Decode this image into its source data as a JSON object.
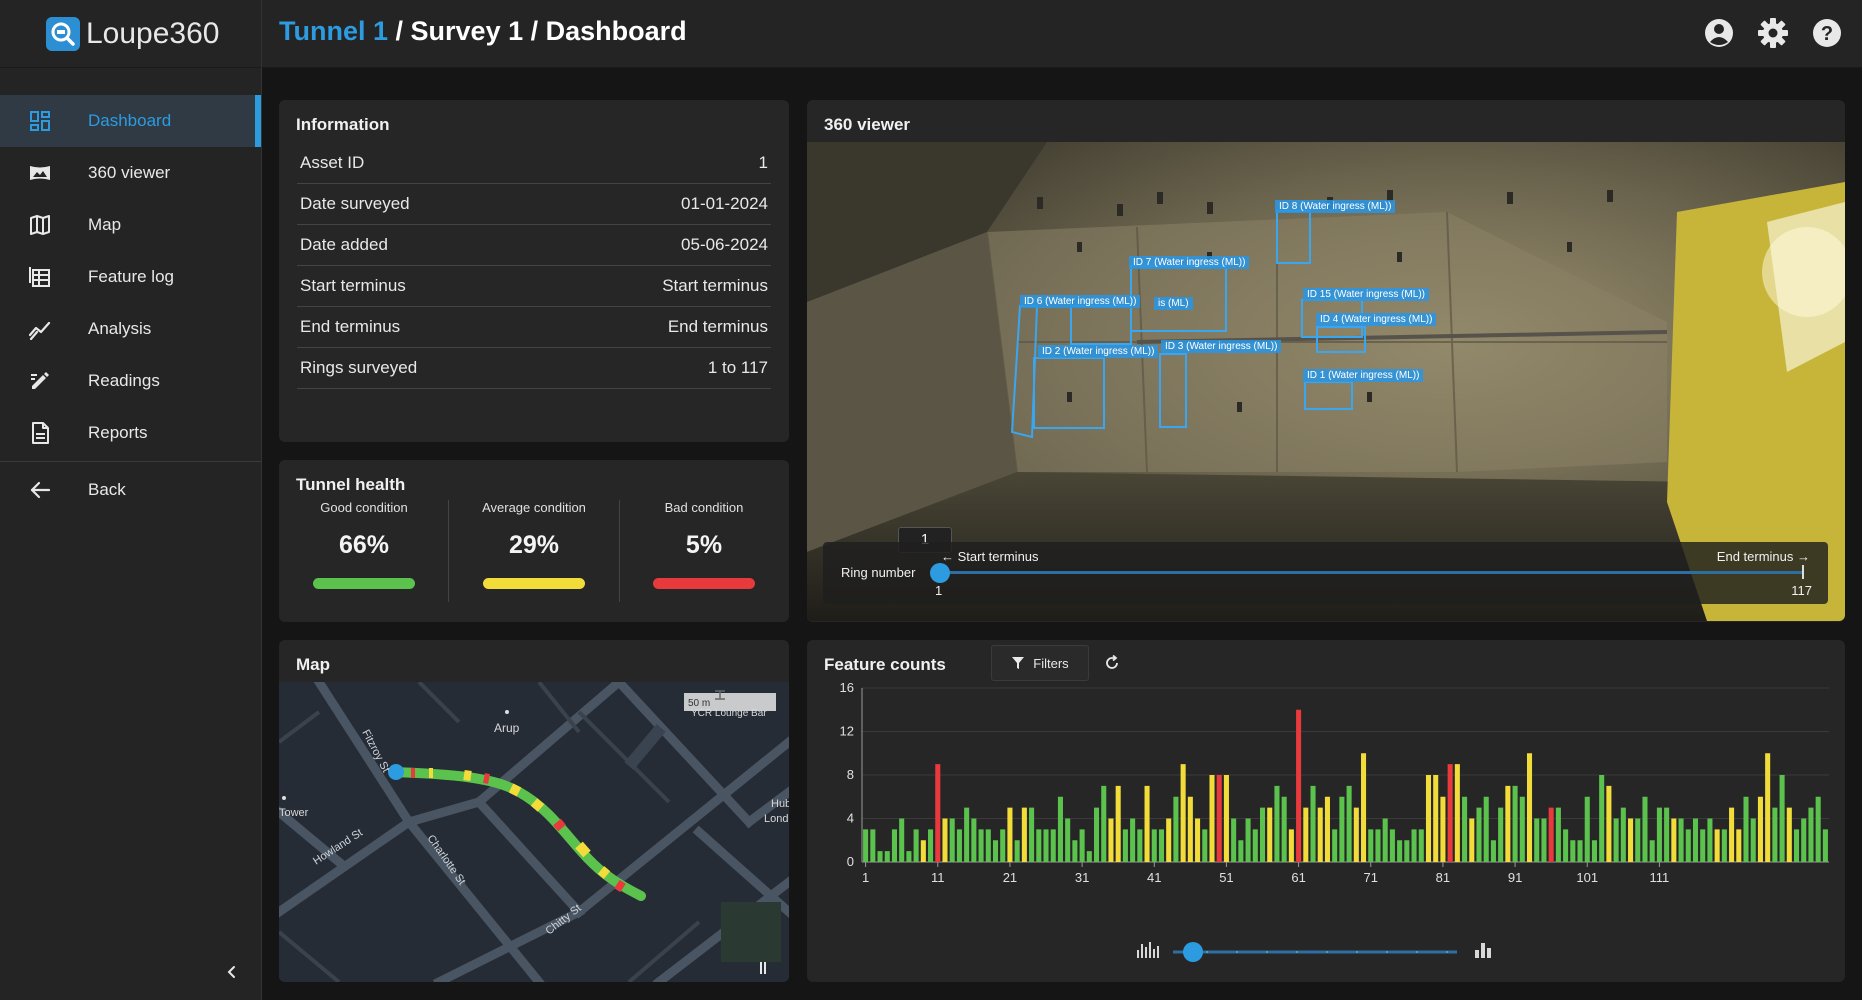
{
  "app": {
    "name": "Loupe360"
  },
  "breadcrumb": {
    "tunnel": "Tunnel 1",
    "sep1": " / ",
    "survey": "Survey 1",
    "sep2": " / ",
    "page": "Dashboard"
  },
  "sidebar": {
    "items": [
      {
        "label": "Dashboard",
        "icon": "dashboard-icon",
        "active": true
      },
      {
        "label": "360 viewer",
        "icon": "panorama-icon"
      },
      {
        "label": "Map",
        "icon": "map-icon"
      },
      {
        "label": "Feature log",
        "icon": "table-icon"
      },
      {
        "label": "Analysis",
        "icon": "trend-icon"
      },
      {
        "label": "Readings",
        "icon": "edit-icon"
      },
      {
        "label": "Reports",
        "icon": "document-icon"
      }
    ],
    "back_label": "Back"
  },
  "information": {
    "title": "Information",
    "rows": [
      {
        "key": "Asset ID",
        "value": "1"
      },
      {
        "key": "Date surveyed",
        "value": "01-01-2024"
      },
      {
        "key": "Date added",
        "value": "05-06-2024"
      },
      {
        "key": "Start terminus",
        "value": "Start terminus"
      },
      {
        "key": "End terminus",
        "value": "End terminus"
      },
      {
        "key": "Rings surveyed",
        "value": "1 to 117"
      }
    ]
  },
  "health": {
    "title": "Tunnel health",
    "good": {
      "label": "Good condition",
      "value": "66%",
      "color": "#5cc24e"
    },
    "average": {
      "label": "Average condition",
      "value": "29%",
      "color": "#f2dc3a"
    },
    "bad": {
      "label": "Bad condition",
      "value": "5%",
      "color": "#e8393d"
    }
  },
  "map": {
    "title": "Map",
    "scale": "50 m",
    "labels": {
      "arup": "Arup",
      "fitzroy": "Fitzroy St",
      "charlotte": "Charlotte St",
      "howland": "Howland St",
      "chitty": "Chitty St",
      "tower": "Tower",
      "bar": "YCR Lounge Bar",
      "hub": "Hub",
      "lond": "Lond"
    }
  },
  "viewer": {
    "title": "360 viewer",
    "detections": [
      "ID 8 (Water ingress (ML))",
      "ID 7 (Water ingress (ML))",
      "ID 15 (Water ingress (ML))",
      "ID 6 (Water ingress (ML))",
      "ID 4 (Water ingress (ML))",
      "ID 2 (Water ingress (ML))",
      "ID 3 (Water ingress (ML))",
      "ID 1 (Water ingress (ML))",
      "is (ML)"
    ],
    "ring": {
      "label": "Ring number",
      "value": "1",
      "min": "1",
      "max": "117",
      "start": "← Start terminus",
      "end": "End terminus →"
    }
  },
  "features": {
    "title": "Feature counts",
    "filters_label": "Filters"
  },
  "colors": {
    "accent": "#2d9be0",
    "good": "#5cc24e",
    "average": "#f2dc3a",
    "bad": "#e8393d"
  },
  "chart_data": {
    "type": "bar",
    "title": "Feature counts",
    "xlabel": "",
    "ylabel": "",
    "ylim": [
      0,
      16
    ],
    "yticks": [
      "0",
      "4",
      "8",
      "12",
      "16"
    ],
    "xticks": [
      "1",
      "11",
      "21",
      "31",
      "41",
      "51",
      "61",
      "71",
      "81",
      "91",
      "101",
      "111"
    ],
    "x_start": 1,
    "values": [
      3,
      3,
      1,
      1,
      3,
      4,
      1,
      3,
      2,
      3,
      9,
      4,
      4,
      3,
      5,
      4,
      3,
      3,
      2,
      3,
      5,
      2,
      5,
      5,
      3,
      3,
      3,
      6,
      4,
      2,
      3,
      1,
      5,
      7,
      4,
      7,
      3,
      4,
      3,
      7,
      3,
      3,
      4,
      6,
      9,
      6,
      4,
      3,
      8,
      8,
      8,
      4,
      2,
      4,
      3,
      5,
      5,
      7,
      6,
      3,
      14,
      5,
      7,
      5,
      6,
      3,
      6,
      7,
      5,
      10,
      3,
      3,
      4,
      3,
      2,
      2,
      3,
      3,
      8,
      8,
      6,
      9,
      9,
      6,
      4,
      5,
      6,
      2,
      5,
      7,
      7,
      6,
      10,
      4,
      4,
      5,
      5,
      3,
      2,
      2,
      6,
      2,
      8,
      7,
      4,
      5,
      4,
      4,
      6,
      2,
      5,
      5,
      4,
      4,
      3,
      4,
      3,
      4,
      3,
      3,
      5,
      3,
      6,
      4,
      6,
      10,
      5,
      8,
      5,
      3,
      4,
      5,
      6,
      3
    ],
    "colors": [
      "g",
      "g",
      "g",
      "g",
      "g",
      "g",
      "g",
      "g",
      "y",
      "g",
      "r",
      "y",
      "g",
      "g",
      "g",
      "g",
      "g",
      "g",
      "g",
      "g",
      "y",
      "g",
      "y",
      "g",
      "g",
      "g",
      "g",
      "g",
      "g",
      "g",
      "g",
      "g",
      "g",
      "g",
      "y",
      "y",
      "g",
      "g",
      "g",
      "y",
      "g",
      "g",
      "y",
      "g",
      "y",
      "y",
      "y",
      "g",
      "y",
      "r",
      "y",
      "g",
      "g",
      "g",
      "g",
      "g",
      "y",
      "g",
      "g",
      "y",
      "r",
      "y",
      "g",
      "y",
      "y",
      "g",
      "g",
      "g",
      "y",
      "y",
      "g",
      "g",
      "g",
      "g",
      "g",
      "g",
      "g",
      "g",
      "y",
      "y",
      "y",
      "r",
      "y",
      "g",
      "y",
      "g",
      "g",
      "g",
      "g",
      "y",
      "g",
      "g",
      "y",
      "g",
      "g",
      "r",
      "g",
      "g",
      "g",
      "g",
      "g",
      "g",
      "g",
      "y",
      "g",
      "g",
      "y",
      "g",
      "g",
      "g",
      "g",
      "g",
      "y",
      "g",
      "g",
      "g",
      "g",
      "g",
      "y",
      "g",
      "y",
      "y",
      "g",
      "g",
      "y",
      "y",
      "g",
      "g",
      "y",
      "g",
      "g",
      "g",
      "g",
      "g"
    ]
  }
}
